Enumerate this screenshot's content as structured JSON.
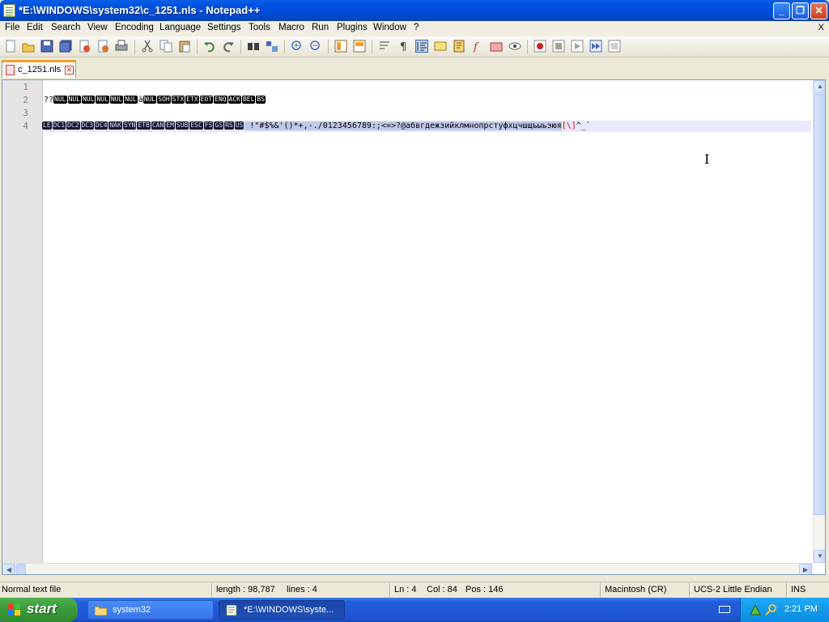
{
  "window": {
    "title": "*E:\\WINDOWS\\system32\\c_1251.nls - Notepad++",
    "buttons": {
      "minimize": "_",
      "maximize": "❐",
      "close": "✕"
    }
  },
  "menu": {
    "items": [
      "File",
      "Edit",
      "Search",
      "View",
      "Encoding",
      "Language",
      "Settings",
      "Tools",
      "Macro",
      "Run",
      "Plugins",
      "Window",
      "?"
    ],
    "close_doc": "X"
  },
  "tab": {
    "label": "c_1251.nls",
    "close": "✕"
  },
  "editor": {
    "line_numbers": [
      "1",
      "2",
      "3",
      "4"
    ],
    "line2": {
      "prefix": "??",
      "tokens": [
        "NUL",
        "NUL",
        "NUL",
        "NUL",
        "NUL",
        "NUL"
      ],
      "mid": "ä",
      "tokens2": [
        "NUL",
        "SOH",
        "STX",
        "ETX",
        "EOT",
        "ENQ",
        "ACK",
        "BEL",
        "BS"
      ]
    },
    "line4": {
      "tokens": [
        "LE",
        "DC1",
        "DC2",
        "DC3",
        "DC4",
        "NAK",
        "SYN",
        "ETB",
        "CAN",
        "EM",
        "SUB",
        "ESC",
        "FS",
        "GS",
        "RS",
        "US"
      ],
      "text": " !\"#$%&'()*+,-./0123456789:;<=>?@абвгдежзийклмнопрстуфхцчшщъыьэюя",
      "red": "[\\]",
      "tail": "^_`"
    }
  },
  "status": {
    "filetype": "Normal text file",
    "length": "length : 98,787",
    "lines": "lines : 4",
    "ln": "Ln : 4",
    "col": "Col : 84",
    "pos": "Pos : 146",
    "eol": "Macintosh (CR)",
    "encoding": "UCS-2 Little Endian",
    "mode": "INS"
  },
  "taskbar": {
    "start": "start",
    "tasks": [
      "system32",
      "*E:\\WINDOWS\\syste..."
    ],
    "clock": "2:21 PM"
  },
  "colors": {
    "title_bar": "#0054e3",
    "taskbar": "#245edb",
    "start": "#3a9a3a",
    "tray": "#0c8ce0"
  }
}
